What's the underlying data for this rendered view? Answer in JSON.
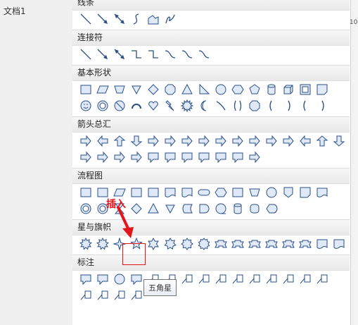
{
  "doc": {
    "title": "文档1",
    "ruler_value": "10"
  },
  "sections": [
    {
      "label": "线条",
      "rows": [
        [
          "line",
          "arrow",
          "double-arrow",
          "curve",
          "freeform",
          "scribble"
        ]
      ]
    },
    {
      "label": "连接符",
      "rows": [
        [
          "line",
          "arrow",
          "double-arrow",
          "elbow",
          "elbow-arrow",
          "curved",
          "curved-arrow",
          "curved-double-arrow"
        ]
      ]
    },
    {
      "label": "基本形状",
      "rows": [
        [
          "rect",
          "parallelogram",
          "trapezoid",
          "triangle-down",
          "diamond",
          "octagon",
          "triangle",
          "right-triangle",
          "circle",
          "hexagon",
          "pentagon",
          "cylinder",
          "cube",
          "frame",
          "folded-corner"
        ],
        [
          "smiley",
          "donut",
          "no-symbol",
          "arc",
          "heart",
          "lightning",
          "sun",
          "moon",
          "wave-line",
          "brace-pair",
          "octagon",
          "bracket-left",
          "bracket-right",
          "brace-left",
          "brace-right"
        ]
      ]
    },
    {
      "label": "箭头总汇",
      "rows": [
        [
          "arrow-right",
          "arrow-left",
          "arrow-up",
          "arrow-down",
          "arrow-leftright",
          "arrow-updown",
          "arrow-quad",
          "arrow-triple",
          "arrow-bent",
          "arrow-uturn",
          "arrow-leftup",
          "arrow-bentup",
          "arrow-curved-right",
          "arrow-curved-left",
          "arrow-curved-up",
          "arrow-curved-down"
        ],
        [
          "arrow-striped",
          "arrow-notched",
          "pentagon-arrow",
          "chevron",
          "callout-right",
          "callout-left",
          "callout-up",
          "callout-down",
          "callout-leftright",
          "callout-quad",
          "arrow-circular"
        ]
      ]
    },
    {
      "label": "流程图",
      "rows": [
        [
          "process",
          "alt-process",
          "data",
          "predefined",
          "internal-storage",
          "document",
          "multidocument",
          "terminator",
          "preparation",
          "manual-input",
          "manual-operation",
          "connector",
          "offpage",
          "card",
          "punched-tape"
        ],
        [
          "summing-junction",
          "or",
          "collate",
          "sort",
          "extract",
          "merge",
          "stored-data",
          "delay",
          "sequential-access",
          "magnetic-disk",
          "direct-access",
          "display"
        ]
      ]
    },
    {
      "label": "星与旗帜",
      "rows": [
        [
          "explosion1",
          "explosion2",
          "star4",
          "star5",
          "star6",
          "star7",
          "star8",
          "star10",
          "ribbon-down",
          "ribbon-up",
          "curved-ribbon-down",
          "curved-ribbon-up",
          "vertical-scroll",
          "horizontal-scroll",
          "wave",
          "double-wave"
        ]
      ]
    },
    {
      "label": "标注",
      "rows": [
        [
          "rect-callout",
          "rounded-callout",
          "oval-callout",
          "cloud-callout",
          "line-callout1",
          "line-callout2",
          "line-callout3",
          "line-callout4",
          "accent-callout1",
          "accent-callout2",
          "accent-callout3",
          "accent-callout4",
          "border-callout1",
          "border-callout2",
          "border-callout3"
        ],
        [
          "accent-border-callout1",
          "accent-border-callout2",
          "accent-border-callout3",
          "accent-border-callout4"
        ]
      ]
    }
  ],
  "annotation": {
    "label": "插入",
    "color": "#e4141b"
  },
  "tooltip": {
    "text": "五角星"
  },
  "colors": {
    "shape_stroke": "#2b4f86",
    "shape_fill": "#dfe9f7",
    "header_bg": "#eeeeee"
  }
}
